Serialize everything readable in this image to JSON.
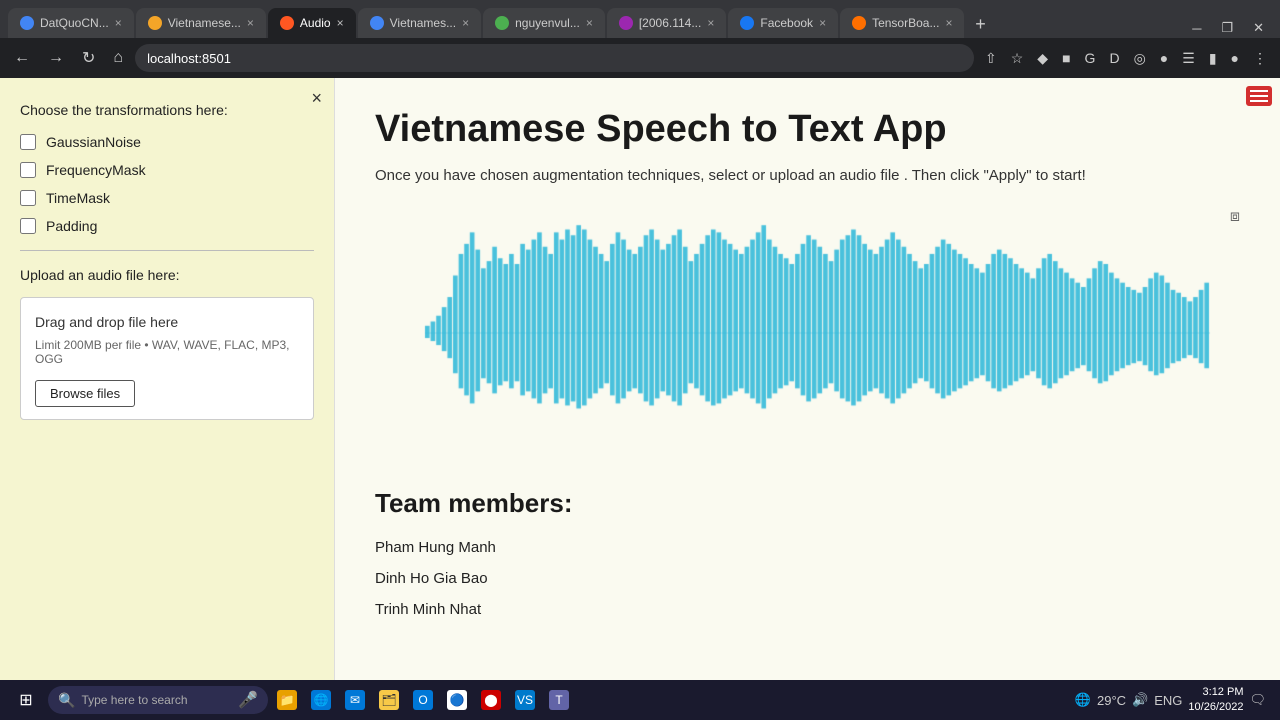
{
  "browser": {
    "address": "localhost:8501",
    "tabs": [
      {
        "id": "tab1",
        "label": "DatQuoCN...",
        "favicon_color": "#4285f4",
        "active": false
      },
      {
        "id": "tab2",
        "label": "Vietnamese...",
        "favicon_color": "#f4a528",
        "active": false
      },
      {
        "id": "tab3",
        "label": "Audio",
        "favicon_color": "#ff5722",
        "active": true
      },
      {
        "id": "tab4",
        "label": "Vietnames...",
        "favicon_color": "#4285f4",
        "active": false
      },
      {
        "id": "tab5",
        "label": "nguyenvul...",
        "favicon_color": "#4caf50",
        "active": false
      },
      {
        "id": "tab6",
        "label": "[2006.114...",
        "favicon_color": "#9c27b0",
        "active": false
      },
      {
        "id": "tab7",
        "label": "Facebook",
        "favicon_color": "#1877f2",
        "active": false
      },
      {
        "id": "tab8",
        "label": "TensorBoa...",
        "favicon_color": "#ff6f00",
        "active": false
      }
    ]
  },
  "sidebar": {
    "close_label": "×",
    "transformations_label": "Choose the transformations here:",
    "checkboxes": [
      {
        "id": "cb1",
        "label": "GaussianNoise",
        "checked": false
      },
      {
        "id": "cb2",
        "label": "FrequencyMask",
        "checked": false
      },
      {
        "id": "cb3",
        "label": "TimeMask",
        "checked": false
      },
      {
        "id": "cb4",
        "label": "Padding",
        "checked": false
      }
    ],
    "upload_label": "Upload an audio file here:",
    "dropzone": {
      "title": "Drag and drop file here",
      "limit_text": "Limit 200MB per file • WAV, WAVE, FLAC, MP3, OGG",
      "browse_label": "Browse files"
    }
  },
  "main": {
    "title": "Vietnamese Speech to Text App",
    "subtitle": "Once you have chosen augmentation techniques, select or upload an audio file . Then click \"Apply\" to start!",
    "team_title": "Team members:",
    "team_members": [
      "Pham Hung Manh",
      "Dinh Ho Gia Bao",
      "Trinh Minh Nhat"
    ]
  },
  "taskbar": {
    "search_placeholder": "Type here to search",
    "time": "3:12 PM",
    "date": "10/26/2022",
    "temperature": "29°C",
    "language": "ENG"
  },
  "waveform": {
    "color": "#29b6d8",
    "bars": [
      5,
      8,
      12,
      18,
      25,
      40,
      55,
      62,
      70,
      58,
      45,
      50,
      60,
      52,
      48,
      55,
      48,
      62,
      58,
      65,
      70,
      60,
      55,
      70,
      65,
      72,
      68,
      75,
      72,
      65,
      60,
      55,
      50,
      62,
      70,
      65,
      58,
      55,
      60,
      68,
      72,
      65,
      58,
      62,
      68,
      72,
      60,
      50,
      55,
      62,
      68,
      72,
      70,
      65,
      62,
      58,
      55,
      60,
      65,
      70,
      75,
      65,
      60,
      55,
      52,
      48,
      55,
      62,
      68,
      65,
      60,
      55,
      50,
      58,
      65,
      68,
      72,
      68,
      62,
      58,
      55,
      60,
      65,
      70,
      65,
      60,
      55,
      50,
      45,
      48,
      55,
      60,
      65,
      62,
      58,
      55,
      52,
      48,
      45,
      42,
      48,
      55,
      58,
      55,
      52,
      48,
      45,
      42,
      38,
      45,
      52,
      55,
      50,
      45,
      42,
      38,
      35,
      32,
      38,
      45,
      50,
      48,
      42,
      38,
      35,
      32,
      30,
      28,
      32,
      38,
      42,
      40,
      35,
      30,
      28,
      25,
      22,
      25,
      30,
      35
    ]
  }
}
